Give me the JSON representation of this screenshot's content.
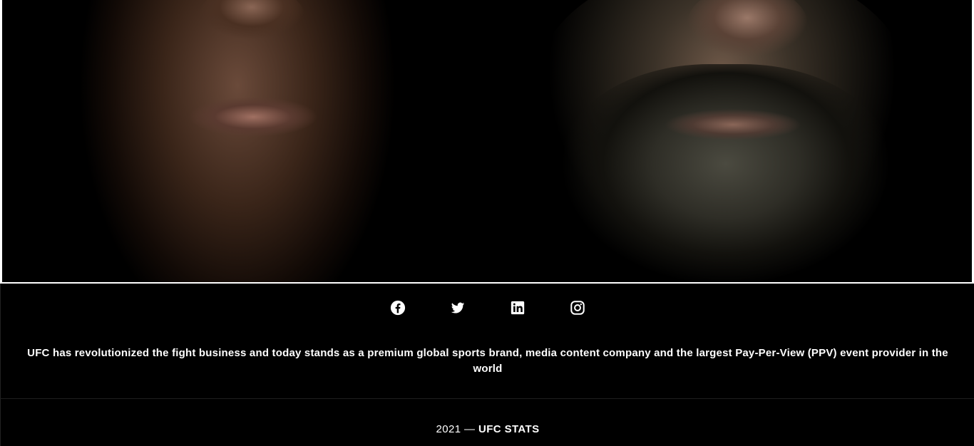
{
  "hero": {
    "image": "fighters-faces-photo"
  },
  "socials": [
    {
      "name": "facebook",
      "icon": "facebook-icon"
    },
    {
      "name": "twitter",
      "icon": "twitter-icon"
    },
    {
      "name": "linkedin",
      "icon": "linkedin-icon"
    },
    {
      "name": "instagram",
      "icon": "instagram-icon"
    }
  ],
  "footer": {
    "tagline": "UFC has revolutionized the fight business and today stands as a premium global sports brand, media content company and the largest Pay-Per-View (PPV) event provider in the world",
    "copyright_year": "2021 — ",
    "copyright_brand": "UFC STATS"
  },
  "colors": {
    "background": "#000000",
    "text": "#ffffff",
    "hero_border": "#ffffff"
  }
}
